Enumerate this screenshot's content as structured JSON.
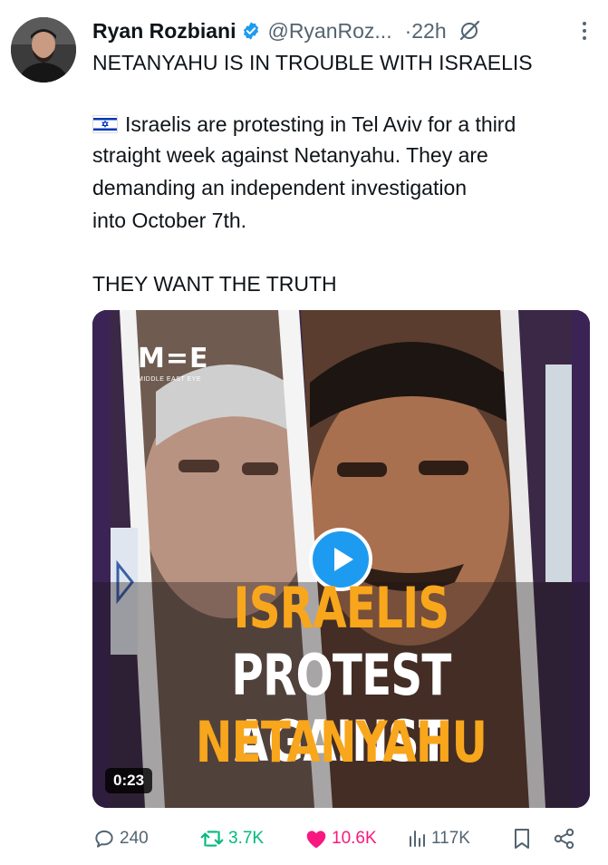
{
  "author": {
    "display_name": "Ryan Rozbiani",
    "handle": "@RyanRoz...",
    "time": "·22h"
  },
  "tweet": {
    "line1": "NETANYAHU IS IN TROUBLE WITH ISRAELIS",
    "para2": [
      "Israelis are protesting in Tel Aviv for a third",
      "straight week against Netanyahu. They are",
      "demanding an independent investigation",
      "into October 7th."
    ],
    "line3": "THEY WANT THE TRUTH"
  },
  "media": {
    "logo": "M=E",
    "logo_sub": "MIDDLE EAST EYE",
    "headline": [
      "ISRAELIS",
      "PROTEST AGAINST",
      "NETANYAHU"
    ],
    "duration": "0:23"
  },
  "actions": {
    "replies": "240",
    "reposts": "3.7K",
    "likes": "10.6K",
    "views": "117K"
  },
  "colors": {
    "verified": "#1d9bf0",
    "repost": "#00ba7c",
    "like": "#f91880",
    "muted": "#536471",
    "headline_accent": "#f8a61c"
  },
  "icons": [
    "verified-badge-icon",
    "grok-icon",
    "more-icon",
    "israel-flag-icon",
    "play-icon",
    "reply-icon",
    "repost-icon",
    "like-icon",
    "views-icon",
    "bookmark-icon",
    "share-icon"
  ]
}
